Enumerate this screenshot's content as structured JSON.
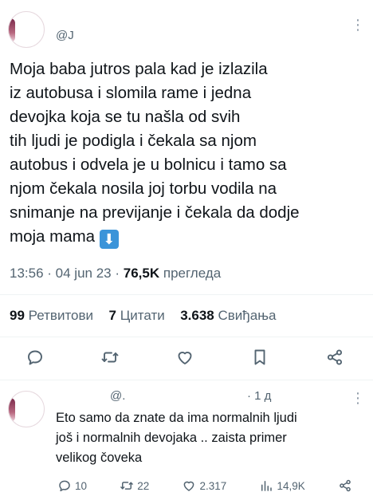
{
  "tweet": {
    "handle": "@J",
    "text": "Moja baba jutros pala kad je izlazila\niz autobusa i slomila rame i jedna\ndevojka koja se tu našla od svih\ntih ljudi je podigla i čekala sa njom\nautobus i odvela je u bolnicu i tamo sa\nnjom čekala nosila joj torbu vodila na\nsnimanje na previjanje i čekala da dodje\nmoja mama",
    "emoji": "⬇",
    "time": "13:56",
    "date": "04 jun 23",
    "views": "76,5K",
    "views_label": "прегледа"
  },
  "stats": {
    "retweets_count": "99",
    "retweets_label": "Ретвитови",
    "quotes_count": "7",
    "quotes_label": "Цитати",
    "likes_count": "3.638",
    "likes_label": "Свиђања"
  },
  "actions": [
    "reply-icon",
    "retweet-icon",
    "like-icon",
    "bookmark-icon",
    "share-icon"
  ],
  "reply": {
    "handle": "@.",
    "time": "1 д",
    "text": "Eto samo da znate da ima normalnih ljudi\njoš i normalnih devojaka .. zaista primer\nvelikog čoveka",
    "replies": "10",
    "retweets": "22",
    "likes": "2.317",
    "views": "14,9K"
  },
  "colors": {
    "text": "#0f1419",
    "muted": "#536471",
    "divider": "#eff3f4",
    "emoji_bg": "#3b94d9"
  }
}
